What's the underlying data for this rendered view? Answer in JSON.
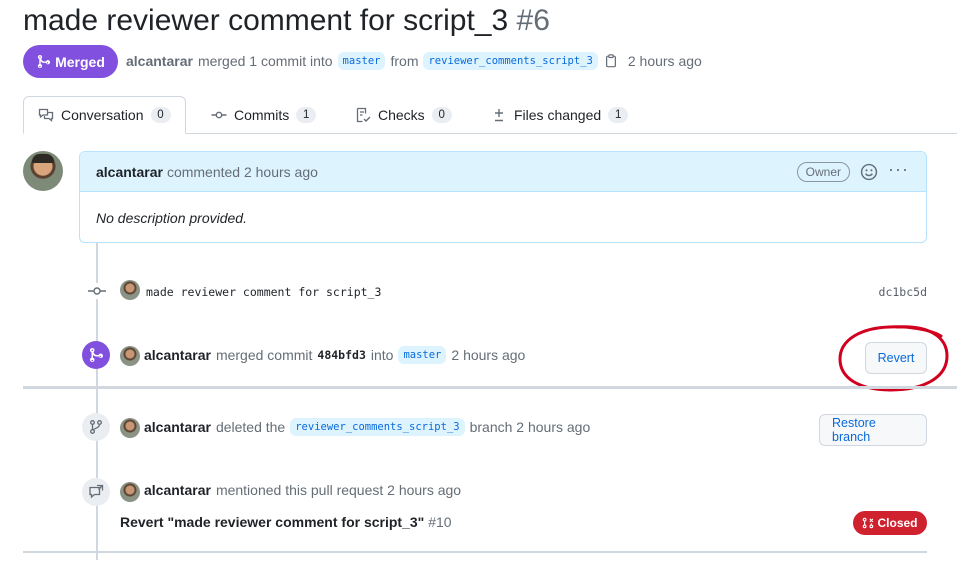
{
  "pr": {
    "title": "made reviewer comment for script_3",
    "number": "#6",
    "status": "Merged",
    "author": "alcantarar",
    "merge_text": "merged 1 commit into",
    "base_branch": "master",
    "from_text": "from",
    "head_branch": "reviewer_comments_script_3",
    "time": "2 hours ago"
  },
  "tabs": [
    {
      "label": "Conversation",
      "count": "0",
      "icon": "comment-discussion-icon"
    },
    {
      "label": "Commits",
      "count": "1",
      "icon": "git-commit-icon"
    },
    {
      "label": "Checks",
      "count": "0",
      "icon": "checklist-icon"
    },
    {
      "label": "Files changed",
      "count": "1",
      "icon": "file-diff-icon"
    }
  ],
  "comment": {
    "author": "alcantarar",
    "action": "commented 2 hours ago",
    "role": "Owner",
    "body": "No description provided."
  },
  "commit": {
    "message": "made reviewer comment for script_3",
    "sha": "dc1bc5d"
  },
  "merge_event": {
    "author": "alcantarar",
    "text1": "merged commit",
    "sha": "484bfd3",
    "text2": "into",
    "branch": "master",
    "time": "2 hours ago",
    "button": "Revert"
  },
  "delete_event": {
    "author": "alcantarar",
    "text1": "deleted the",
    "branch": "reviewer_comments_script_3",
    "text2": "branch 2 hours ago",
    "button": "Restore branch"
  },
  "mention_event": {
    "author": "alcantarar",
    "text": "mentioned this pull request 2 hours ago",
    "ref_title": "Revert \"made reviewer comment for script_3\"",
    "ref_number": "#10",
    "ref_status": "Closed"
  },
  "colors": {
    "merged": "#8250df",
    "closed": "#cf222e",
    "link": "#0969da",
    "annotation": "#d1001f"
  }
}
